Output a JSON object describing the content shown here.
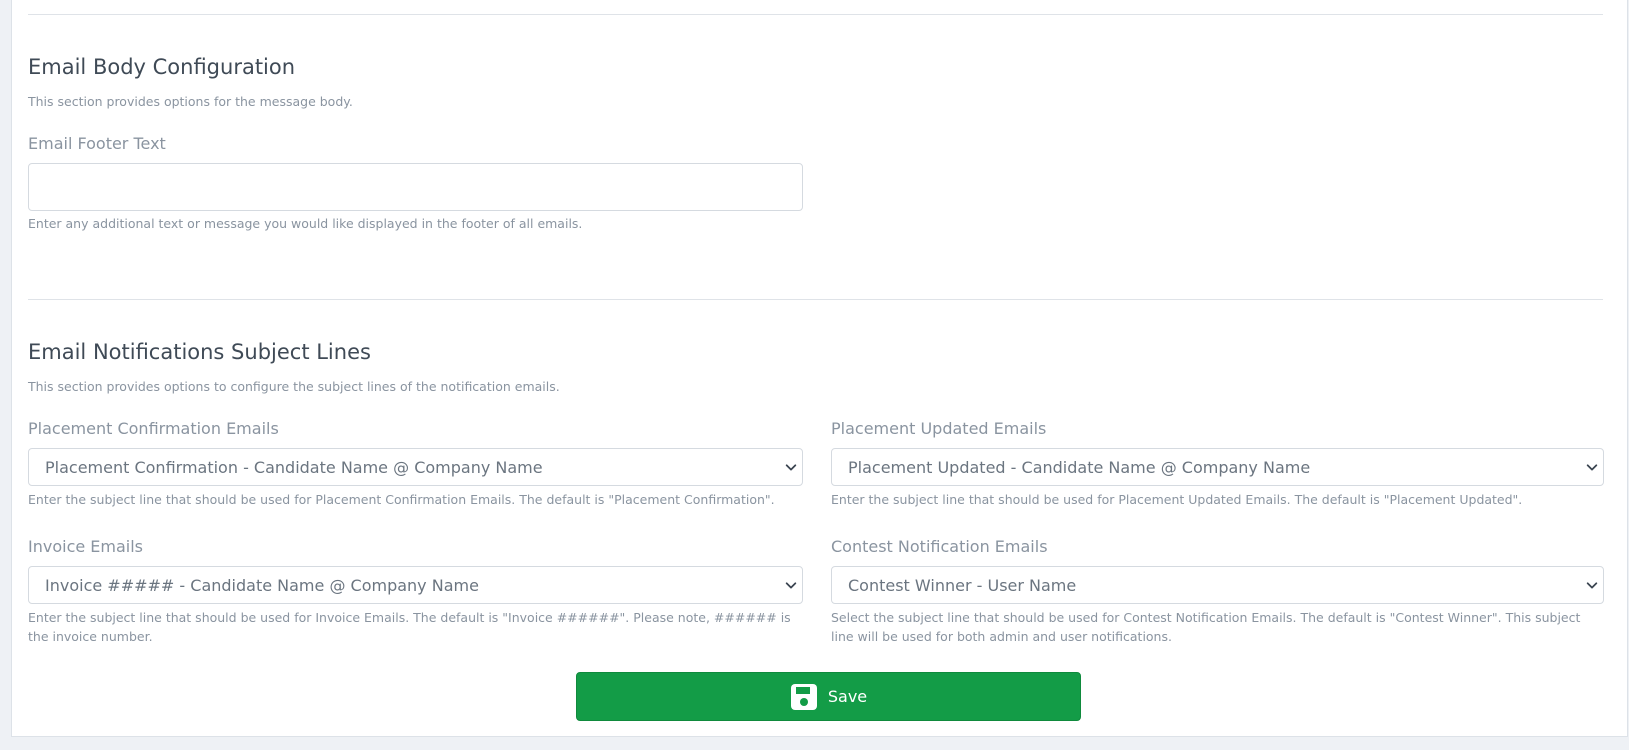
{
  "body_section": {
    "title": "Email Body Configuration",
    "description": "This section provides options for the message body.",
    "footer_field": {
      "label": "Email Footer Text",
      "value": "",
      "placeholder": "",
      "help": "Enter any additional text or message you would like displayed in the footer of all emails."
    }
  },
  "subject_section": {
    "title": "Email Notifications Subject Lines",
    "description": "This section provides options to configure the subject lines of the notification emails.",
    "fields": [
      {
        "label": "Placement Confirmation Emails",
        "selected": "Placement Confirmation - Candidate Name @ Company Name",
        "help": "Enter the subject line that should be used for Placement Confirmation Emails. The default is \"Placement Confirmation\"."
      },
      {
        "label": "Placement Updated Emails",
        "selected": "Placement Updated - Candidate Name @ Company Name",
        "help": "Enter the subject line that should be used for Placement Updated Emails. The default is \"Placement Updated\"."
      },
      {
        "label": "Invoice Emails",
        "selected": "Invoice ##### - Candidate Name @ Company Name",
        "help": "Enter the subject line that should be used for Invoice Emails. The default is \"Invoice ######\". Please note, ###### is the invoice number."
      },
      {
        "label": "Contest Notification Emails",
        "selected": "Contest Winner - User Name",
        "help": "Select the subject line that should be used for Contest Notification Emails. The default is \"Contest Winner\". This subject line will be used for both admin and user notifications."
      }
    ]
  },
  "save_button": {
    "label": "Save",
    "icon": "floppy-disk-icon",
    "color": "#139c47"
  }
}
